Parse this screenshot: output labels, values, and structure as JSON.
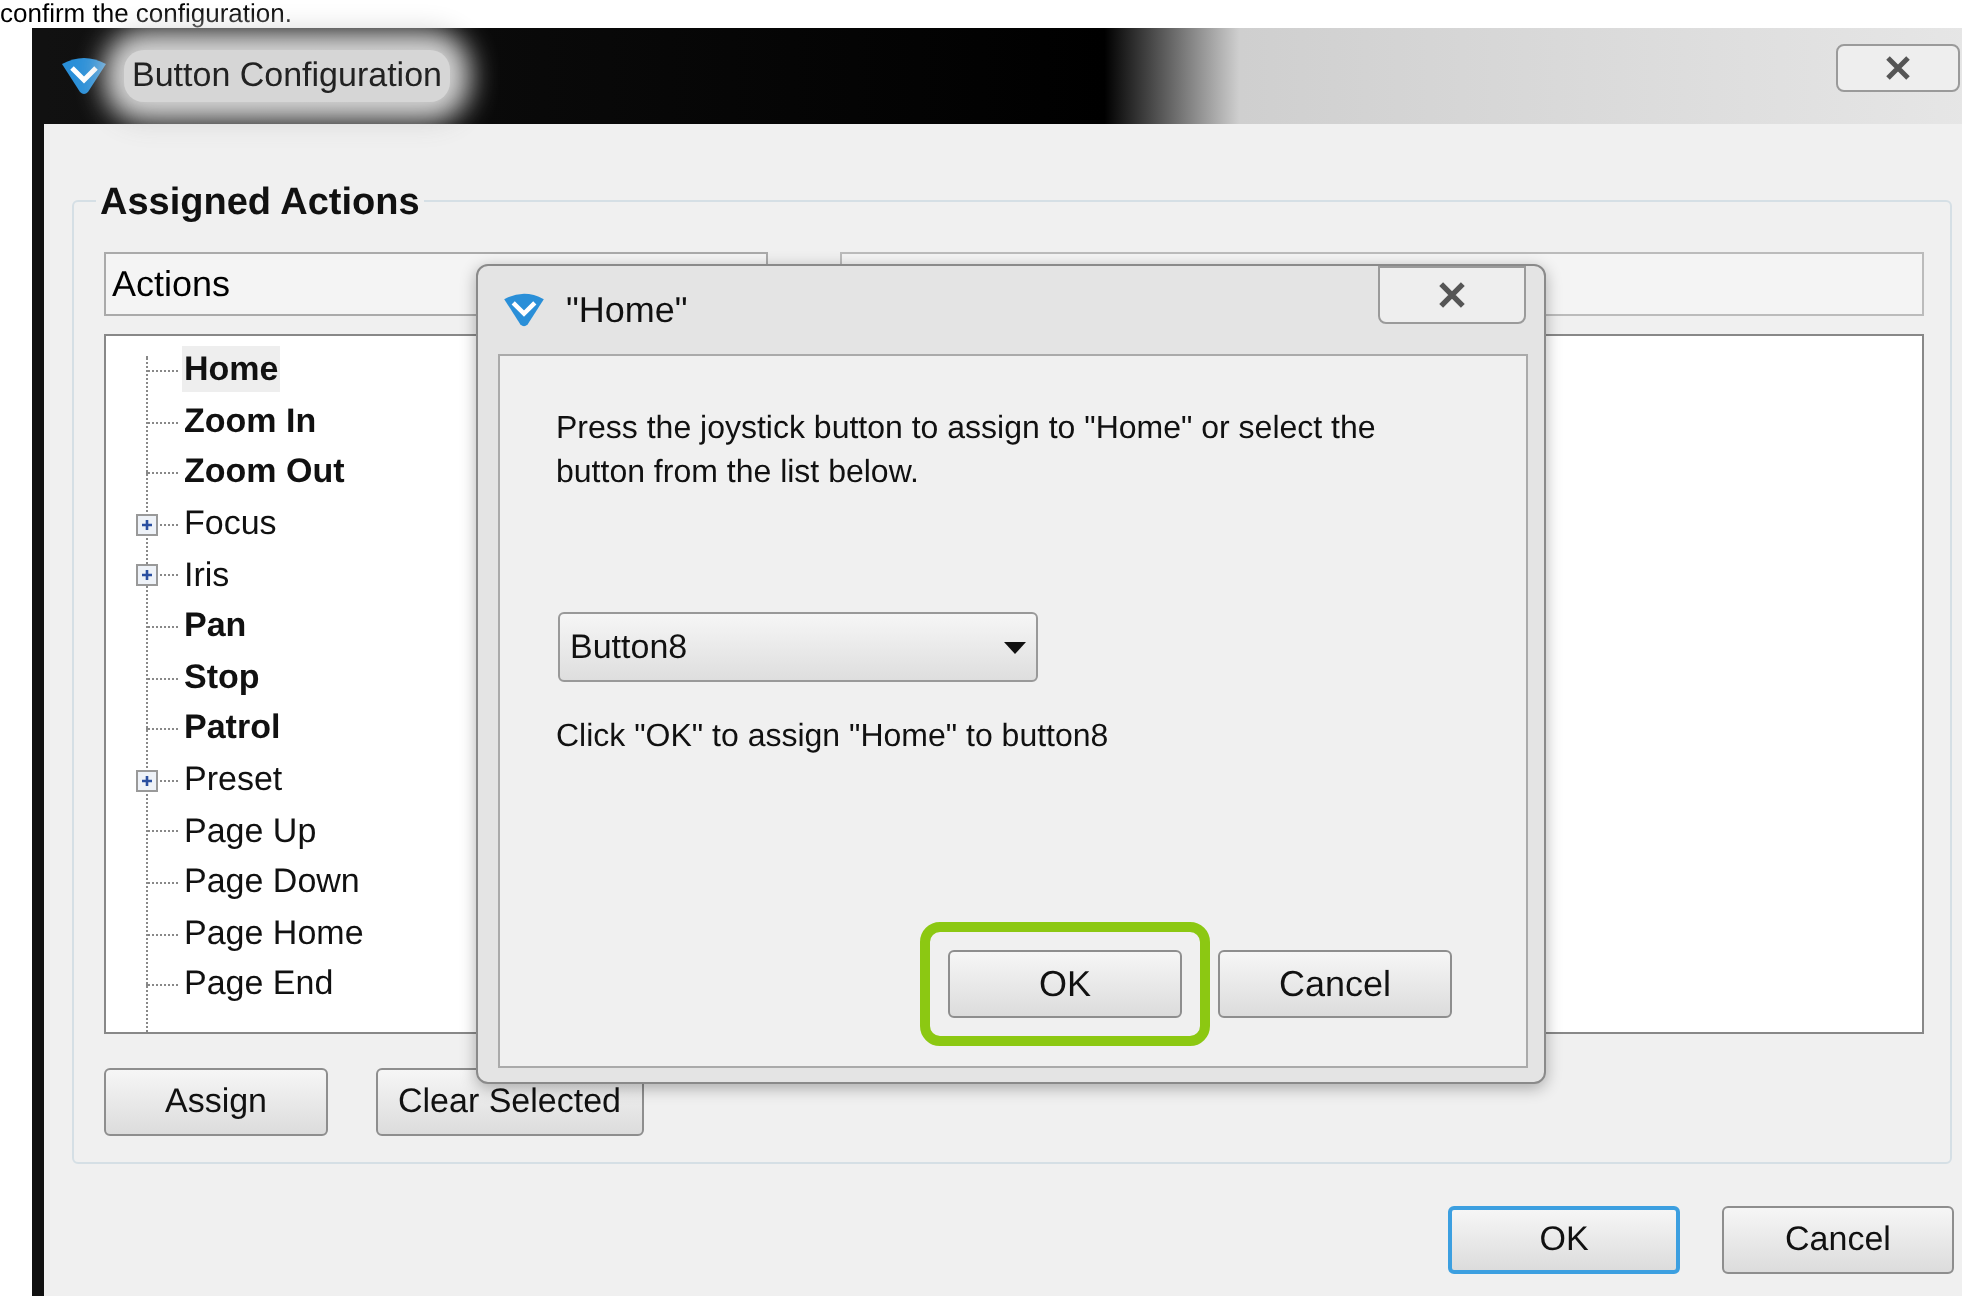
{
  "caption": "confirm the configuration.",
  "window": {
    "title": "Button Configuration"
  },
  "group": {
    "title": "Assigned Actions",
    "actions_header": "Actions",
    "tree": [
      {
        "label": "Home",
        "kind": "leaf",
        "bold": true,
        "selected": true
      },
      {
        "label": "Zoom In",
        "kind": "leaf",
        "bold": true,
        "selected": false
      },
      {
        "label": "Zoom Out",
        "kind": "leaf",
        "bold": true,
        "selected": false
      },
      {
        "label": "Focus",
        "kind": "group",
        "bold": false,
        "selected": false
      },
      {
        "label": "Iris",
        "kind": "group",
        "bold": false,
        "selected": false
      },
      {
        "label": "Pan",
        "kind": "leaf",
        "bold": true,
        "selected": false
      },
      {
        "label": "Stop",
        "kind": "leaf",
        "bold": true,
        "selected": false
      },
      {
        "label": "Patrol",
        "kind": "leaf",
        "bold": true,
        "selected": false
      },
      {
        "label": "Preset",
        "kind": "group",
        "bold": false,
        "selected": false
      },
      {
        "label": "Page Up",
        "kind": "leaf",
        "bold": false,
        "selected": false
      },
      {
        "label": "Page Down",
        "kind": "leaf",
        "bold": false,
        "selected": false
      },
      {
        "label": "Page Home",
        "kind": "leaf",
        "bold": false,
        "selected": false
      },
      {
        "label": "Page End",
        "kind": "leaf",
        "bold": false,
        "selected": false
      }
    ],
    "buttons": [
      "Assign",
      "Clear Selected"
    ]
  },
  "footer_buttons": [
    {
      "label": "OK",
      "default": true
    },
    {
      "label": "Cancel",
      "default": false
    }
  ],
  "dialog": {
    "title": "\"Home\"",
    "message": "Press the joystick button to assign to \"Home\" or select the button from the list below.",
    "select": {
      "value": "Button8"
    },
    "hint": "Click \"OK\" to assign \"Home\" to button8",
    "buttons": [
      {
        "label": "OK",
        "highlighted": true
      },
      {
        "label": "Cancel",
        "highlighted": false
      }
    ]
  }
}
